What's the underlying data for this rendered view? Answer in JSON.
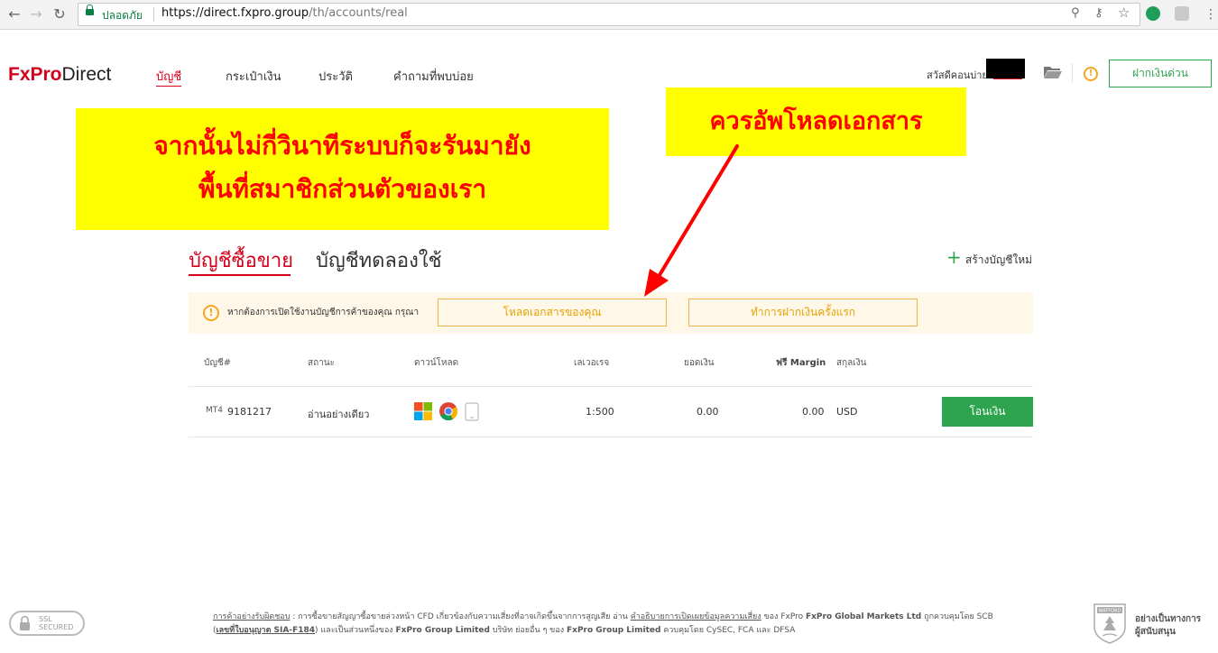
{
  "browser": {
    "secure_label": "ปลอดภัย",
    "url_host": "https://direct.fxpro.group",
    "url_path": "/th/accounts/real"
  },
  "header": {
    "logo_fx": "FxPro",
    "logo_direct": "Direct",
    "nav": [
      {
        "label": "บัญชี"
      },
      {
        "label": "กระเป๋าเงิน"
      },
      {
        "label": "ประวัติ"
      },
      {
        "label": "คำถามที่พบบ่อย"
      }
    ],
    "greeting": "สวัสดีคอนบ่าย",
    "deposit_button": "ฝากเงินด่วน",
    "warn_symbol": "!"
  },
  "overlays": {
    "box1_line1": "จากนั้นไม่กี่วินาทีระบบก็จะรันมายัง",
    "box1_line2": "พื้นที่สมาชิกส่วนตัวของเรา",
    "box2": "ควรอัพโหลดเอกสาร"
  },
  "tabs": {
    "real": "บัญชีซื้อขาย",
    "demo": "บัญชีทดลองใช้",
    "create_plus": "+",
    "create": "สร้างบัญชีใหม่"
  },
  "notice": {
    "text": "หากต้องการเปิดใช้งานบัญชีการค้าของคุณ กรุณา",
    "upload_button": "โหลดเอกสารของคุณ",
    "first_deposit_button": "ทำการฝากเงินครั้งแรก",
    "warn_symbol": "!"
  },
  "table": {
    "headers": {
      "account": "บัญชี#",
      "status": "สถานะ",
      "download": "ดาวน์โหลด",
      "leverage": "เลเวอเรจ",
      "balance": "ยอดเงิน",
      "free_margin": "ฟรี Margin",
      "currency": "สกุลเงิน"
    },
    "row": {
      "platform": "MT4",
      "account": "9181217",
      "status": "อ่านอย่างเดียว",
      "leverage": "1:500",
      "balance": "0.00",
      "free_margin": "0.00",
      "currency": "USD",
      "transfer_button": "โอนเงิน"
    }
  },
  "footer": {
    "ssl_line1": "SSL",
    "ssl_line2": "SECURED",
    "risk_link": "การค้าอย่างรับผิดชอบ",
    "text1": ": การซื้อขายสัญญาซื้อขายล่วงหน้า CFD เกี่ยวข้องกับความเสี่ยงที่อาจเกิดขึ้นจากการสูญเสีย อ่าน",
    "disclosure_link": "คำอธิบายการเปิดเผยข้อมูลความเสี่ยง",
    "text2": "ของ FxPro",
    "entity1": "FxPro Global Markets Ltd",
    "text3": "ถูกควบคุมโดย SCB (",
    "license_link": "เลขที่ใบอนุญาต SIA-F184",
    "text4": ") และเป็นส่วนหนึ่งของ",
    "entity2": "FxPro Group Limited",
    "text5": "บริษัท ย่อยอื่น ๆ ของ",
    "entity3": "FxPro Group Limited",
    "text6": "ควบคุมโดย CySEC, FCA และ DFSA",
    "watford": "WATFORD",
    "sponsor_line1": "อย่างเป็นทางการ",
    "sponsor_line2": "ผู้สนับสนุน"
  }
}
